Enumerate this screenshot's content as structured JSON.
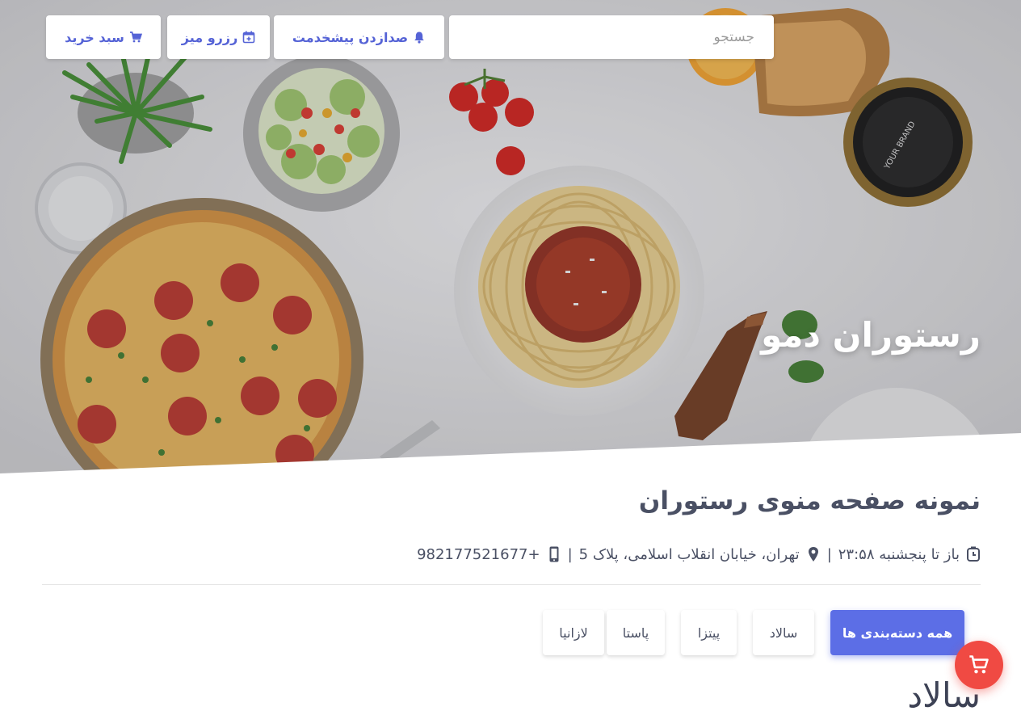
{
  "header": {
    "search_placeholder": "جستجو",
    "call_waiter_label": "صدازدن پیشخدمت",
    "reserve_label": "رزرو میز",
    "cart_label": "سبد خرید"
  },
  "hero": {
    "restaurant_name": "رستوران دمو"
  },
  "info": {
    "title": "نمونه صفحه منوی رستوران",
    "hours": "باز تا پنجشنبه ۲۳:۵۸",
    "address": "تهران، خیابان انقلاب اسلامی، پلاک 5",
    "phone": "982177521677+",
    "separator": "|"
  },
  "categories": [
    {
      "label": "همه دسته‌بندی ها",
      "active": true
    },
    {
      "label": "سالاد",
      "active": false
    },
    {
      "label": "پیتزا",
      "active": false
    },
    {
      "label": "پاستا",
      "active": false
    },
    {
      "label": "لازانیا",
      "active": false
    }
  ],
  "section": {
    "heading": "سالاد"
  },
  "colors": {
    "accent": "#5c6ee6",
    "fab": "#f04a43",
    "text": "#4a5064"
  },
  "icons": {
    "call_waiter": "bell-icon",
    "reserve": "calendar-plus-icon",
    "cart": "shopping-cart-icon",
    "hours": "clock-icon",
    "address": "map-pin-icon",
    "phone": "mobile-phone-icon",
    "fab": "shopping-cart-icon"
  }
}
